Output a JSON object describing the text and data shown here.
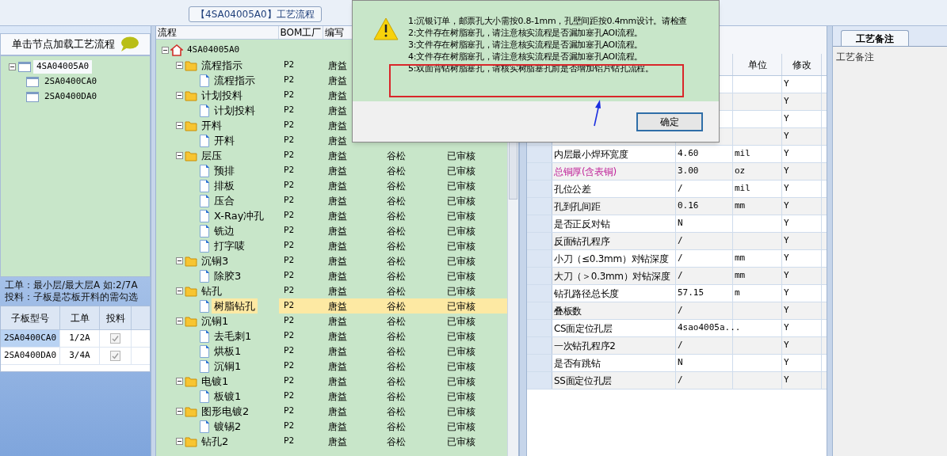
{
  "document_tab": "【4SA04005A0】工艺流程",
  "left_panel": {
    "header": "单击节点加载工艺流程",
    "tree": [
      {
        "label": "4SA04005A0",
        "selected": true,
        "expanded": true,
        "children": [
          {
            "label": "2SA0400CA0",
            "selected": false
          },
          {
            "label": "2SA0400DA0",
            "selected": false
          }
        ]
      }
    ],
    "note_lines": [
      "工单：最小层/最大层A 如:2/7A",
      "投料：子板是芯板开料的需勾选"
    ],
    "table": {
      "columns": [
        "子板型号",
        "工单",
        "投料"
      ],
      "rows": [
        {
          "model": "2SA0400CA0",
          "order": "1/2A",
          "feed": true,
          "selected": true
        },
        {
          "model": "2SA0400DA0",
          "order": "3/4A",
          "feed": true,
          "selected": false
        }
      ]
    }
  },
  "process": {
    "columns": [
      "流程",
      "BOM工厂",
      "编写"
    ],
    "tree": [
      {
        "kind": "root",
        "label": "4SA04005A0",
        "expanded": true,
        "selected": false,
        "children": [
          {
            "kind": "folder",
            "label": "流程指示",
            "expanded": true,
            "selected": false,
            "bom_plant": "P2",
            "writer": "唐益",
            "children": [
              {
                "kind": "step",
                "label": "流程指示",
                "selected": false,
                "bom_plant": "P2",
                "writer": "唐益"
              }
            ]
          },
          {
            "kind": "folder",
            "label": "计划投料",
            "expanded": true,
            "selected": false,
            "bom_plant": "P2",
            "writer": "唐益",
            "children": [
              {
                "kind": "step",
                "label": "计划投料",
                "selected": false,
                "bom_plant": "P2",
                "writer": "唐益"
              }
            ]
          },
          {
            "kind": "folder",
            "label": "开料",
            "expanded": true,
            "selected": false,
            "bom_plant": "P2",
            "writer": "唐益",
            "children": [
              {
                "kind": "step",
                "label": "开料",
                "selected": false,
                "bom_plant": "P2",
                "writer": "唐益"
              }
            ]
          },
          {
            "kind": "folder",
            "label": "层压",
            "expanded": true,
            "selected": false,
            "bom_plant": "P2",
            "writer": "唐益",
            "column_4": "谷松",
            "column_5": "已审核",
            "children": [
              {
                "kind": "step",
                "label": "预排",
                "selected": false,
                "bom_plant": "P2",
                "writer": "唐益",
                "column_4": "谷松",
                "column_5": "已审核"
              },
              {
                "kind": "step",
                "label": "排板",
                "selected": false,
                "bom_plant": "P2",
                "writer": "唐益",
                "column_4": "谷松",
                "column_5": "已审核"
              },
              {
                "kind": "step",
                "label": "压合",
                "selected": false,
                "bom_plant": "P2",
                "writer": "唐益",
                "column_4": "谷松",
                "column_5": "已审核"
              },
              {
                "kind": "step",
                "label": "X-Ray冲孔",
                "selected": false,
                "bom_plant": "P2",
                "writer": "唐益",
                "column_4": "谷松",
                "column_5": "已审核"
              },
              {
                "kind": "step",
                "label": "铣边",
                "selected": false,
                "bom_plant": "P2",
                "writer": "唐益",
                "column_4": "谷松",
                "column_5": "已审核"
              },
              {
                "kind": "step",
                "label": "打字唛",
                "selected": false,
                "bom_plant": "P2",
                "writer": "唐益",
                "column_4": "谷松",
                "column_5": "已审核"
              }
            ]
          },
          {
            "kind": "folder",
            "label": "沉铜3",
            "expanded": true,
            "selected": false,
            "bom_plant": "P2",
            "writer": "唐益",
            "column_4": "谷松",
            "column_5": "已审核",
            "children": [
              {
                "kind": "step",
                "label": "除胶3",
                "selected": false,
                "bom_plant": "P2",
                "writer": "唐益",
                "column_4": "谷松",
                "column_5": "已审核"
              }
            ]
          },
          {
            "kind": "folder",
            "label": "钻孔",
            "expanded": true,
            "selected": false,
            "bom_plant": "P2",
            "writer": "唐益",
            "column_4": "谷松",
            "column_5": "已审核",
            "children": [
              {
                "kind": "step",
                "label": "树脂钻孔",
                "selected": true,
                "bom_plant": "P2",
                "writer": "唐益",
                "column_4": "谷松",
                "column_5": "已审核"
              }
            ]
          },
          {
            "kind": "folder",
            "label": "沉铜1",
            "expanded": true,
            "selected": false,
            "bom_plant": "P2",
            "writer": "唐益",
            "column_4": "谷松",
            "column_5": "已审核",
            "children": [
              {
                "kind": "step",
                "label": "去毛刺1",
                "selected": false,
                "bom_plant": "P2",
                "writer": "唐益",
                "column_4": "谷松",
                "column_5": "已审核"
              },
              {
                "kind": "step",
                "label": "烘板1",
                "selected": false,
                "bom_plant": "P2",
                "writer": "唐益",
                "column_4": "谷松",
                "column_5": "已审核"
              },
              {
                "kind": "step",
                "label": "沉铜1",
                "selected": false,
                "bom_plant": "P2",
                "writer": "唐益",
                "column_4": "谷松",
                "column_5": "已审核"
              }
            ]
          },
          {
            "kind": "folder",
            "label": "电镀1",
            "expanded": true,
            "selected": false,
            "bom_plant": "P2",
            "writer": "唐益",
            "column_4": "谷松",
            "column_5": "已审核",
            "children": [
              {
                "kind": "step",
                "label": "板镀1",
                "selected": false,
                "bom_plant": "P2",
                "writer": "唐益",
                "column_4": "谷松",
                "column_5": "已审核"
              }
            ]
          },
          {
            "kind": "folder",
            "label": "图形电镀2",
            "expanded": true,
            "selected": false,
            "bom_plant": "P2",
            "writer": "唐益",
            "column_4": "谷松",
            "column_5": "已审核",
            "children": [
              {
                "kind": "step",
                "label": "镀锡2",
                "selected": false,
                "bom_plant": "P2",
                "writer": "唐益",
                "column_4": "谷松",
                "column_5": "已审核"
              }
            ]
          },
          {
            "kind": "folder",
            "label": "钻孔2",
            "expanded": true,
            "selected": false,
            "bom_plant": "P2",
            "writer": "唐益",
            "column_4": "谷松",
            "column_5": "已审核"
          }
        ]
      }
    ]
  },
  "parameters": {
    "columns": [
      "单位",
      "修改"
    ],
    "rows": [
      {
        "modified": "Y"
      },
      {
        "modified": "Y"
      },
      {
        "modified": "Y"
      },
      {
        "modified": "Y"
      },
      {
        "name": "内层最小焊环宽度",
        "value": "4.60",
        "unit": "mil",
        "modified": "Y",
        "highlighted": false
      },
      {
        "name": "总铜厚(含表铜)",
        "value": "3.00",
        "unit": "oz",
        "modified": "Y",
        "highlighted": true
      },
      {
        "name": "孔位公差",
        "value": "/",
        "unit": "mil",
        "modified": "Y",
        "highlighted": false
      },
      {
        "name": "孔到孔间距",
        "value": "0.16",
        "unit": "mm",
        "modified": "Y",
        "highlighted": false
      },
      {
        "name": "是否正反对钻",
        "value": "N",
        "modified": "Y",
        "highlighted": false
      },
      {
        "name": "反面钻孔程序",
        "value": "/",
        "modified": "Y",
        "highlighted": false
      },
      {
        "name": "小刀（≤0.3mm）对钻深度",
        "value": "/",
        "unit": "mm",
        "modified": "Y",
        "highlighted": false
      },
      {
        "name": "大刀（＞0.3mm）对钻深度",
        "value": "/",
        "unit": "mm",
        "modified": "Y",
        "highlighted": false
      },
      {
        "name": "钻孔路径总长度",
        "value": "57.15",
        "unit": "m",
        "modified": "Y",
        "highlighted": false
      },
      {
        "name": "叠板数",
        "value": "/",
        "modified": "Y",
        "highlighted": false
      },
      {
        "name": "CS面定位孔层",
        "value": "4sao4005a...",
        "modified": "Y",
        "highlighted": false
      },
      {
        "name": "一次钻孔程序2",
        "value": "/",
        "modified": "Y",
        "highlighted": false
      },
      {
        "name": "是否有跳钻",
        "value": "N",
        "modified": "Y",
        "highlighted": false
      },
      {
        "name": "SS面定位孔层",
        "value": "/",
        "modified": "Y",
        "highlighted": false
      }
    ]
  },
  "notes_panel": {
    "tab": "工艺备注",
    "label": "工艺备注"
  },
  "dialog": {
    "messages": [
      "1:沉银订单，邮票孔大小需按0.8-1mm，孔壁间距按0.4mm设计。请检查",
      "2:文件存在树脂塞孔，请注意核实流程是否漏加塞孔AOI流程。",
      "3:文件存在树脂塞孔，请注意核实流程是否漏加塞孔AOI流程。",
      "4:文件存在树脂塞孔，请注意核实流程是否漏加塞孔AOI流程。",
      "5:双面背钻树脂塞孔，请核实树脂塞孔前是否增加铝片钻孔流程。"
    ],
    "button": "确定"
  }
}
